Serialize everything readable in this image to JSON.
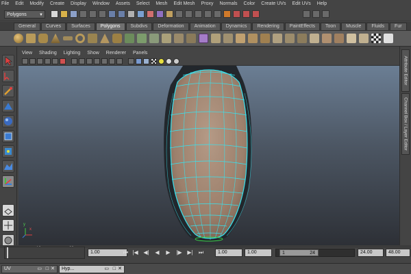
{
  "menu": {
    "items": [
      "File",
      "Edit",
      "Modify",
      "Create",
      "Display",
      "Window",
      "Assets",
      "Select",
      "Mesh",
      "Edit Mesh",
      "Proxy",
      "Normals",
      "Color",
      "Create UVs",
      "Edit UVs",
      "Help"
    ]
  },
  "status_line": {
    "mode": "Polygons"
  },
  "shelf": {
    "tabs": [
      "General",
      "Curves",
      "Surfaces",
      "Polygons",
      "Subdivs",
      "Deformation",
      "Animation",
      "Dynamics",
      "Rendering",
      "PaintEffects",
      "Toon",
      "Muscle",
      "Fluids",
      "Fur"
    ],
    "active_tab": "Polygons"
  },
  "panel": {
    "menus": [
      "View",
      "Shading",
      "Lighting",
      "Show",
      "Renderer",
      "Panels"
    ]
  },
  "right_tabs": {
    "attribute_editor": "Attribute Editor",
    "channel_box": "Channel Box / Layer Editor"
  },
  "viewport": {
    "axis_x": "x",
    "axis_y": "y"
  },
  "time_slider": {
    "tick_1": "1",
    "tick_10": "10",
    "tick_20": "20"
  },
  "range": {
    "current_time": "1.00",
    "start_time": "1.00",
    "playback_start": "1.00",
    "range_start": "1",
    "range_end": "24",
    "playback_end": "24.00",
    "end_time": "48.00"
  },
  "taskbar": {
    "win1": "UV",
    "win2": "Hyp..."
  },
  "colors": {
    "mesh_fill": "#a88c78",
    "wire": "#37e3f0",
    "viewport_top": "#6b7e94",
    "viewport_bottom": "#2d3036"
  }
}
